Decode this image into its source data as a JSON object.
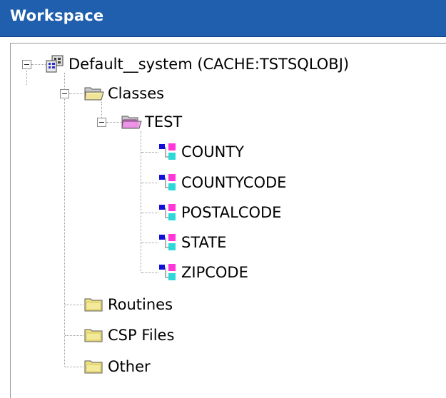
{
  "header": {
    "title": "Workspace"
  },
  "tree": {
    "root": {
      "label": "Default__system  (CACHE:TSTSQLOBJ)"
    },
    "classes": {
      "label": "Classes"
    },
    "package": {
      "label": "TEST"
    },
    "class_items": [
      "COUNTY",
      "COUNTYCODE",
      "POSTALCODE",
      "STATE",
      "ZIPCODE"
    ],
    "routines": {
      "label": "Routines"
    },
    "csp_files": {
      "label": "CSP Files"
    },
    "other": {
      "label": "Other"
    }
  }
}
